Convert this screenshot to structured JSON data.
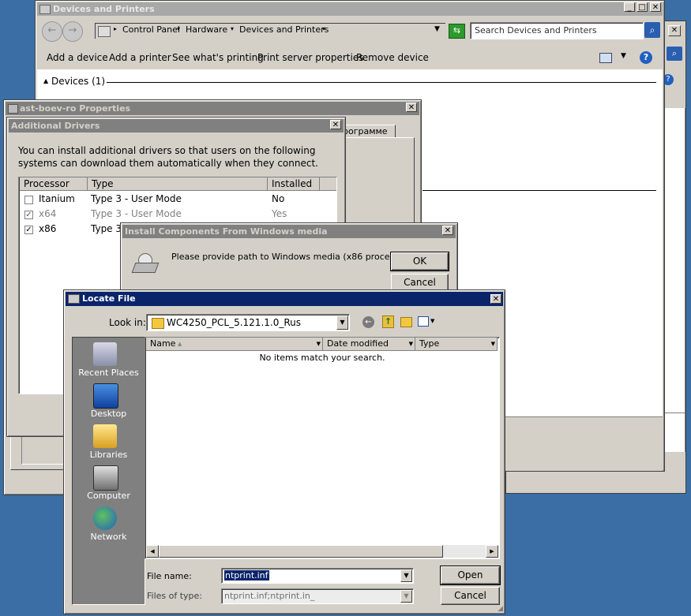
{
  "devices_window": {
    "title": "Devices and Printers",
    "breadcrumb": [
      "Control Panel",
      "Hardware",
      "Devices and Printers"
    ],
    "search_placeholder": "Search Devices and Printers",
    "toolbar": [
      "Add a device",
      "Add a printer",
      "See what's printing",
      "Print server properties",
      "Remove device"
    ],
    "devices_group": "Devices (1)"
  },
  "properties_window": {
    "title": "ast-boev-ro Properties",
    "tab_fragment": "рограмме"
  },
  "additional_drivers": {
    "title": "Additional Drivers",
    "description": "You can install additional drivers so that users on the following systems can download them automatically when they connect.",
    "columns": [
      "Processor",
      "Type",
      "Installed"
    ],
    "rows": [
      {
        "processor": "Itanium",
        "type": "Type 3 - User Mode",
        "installed": "No",
        "checked": false,
        "disabled": false
      },
      {
        "processor": "x64",
        "type": "Type 3 - User Mode",
        "installed": "Yes",
        "checked": true,
        "disabled": true
      },
      {
        "processor": "x86",
        "type": "Type 3",
        "installed": "",
        "checked": true,
        "disabled": false
      }
    ]
  },
  "install_dialog": {
    "title": "Install Components From Windows media",
    "message": "Please provide path to Windows media (x86 processor).",
    "ok_label": "OK",
    "cancel_label": "Cancel"
  },
  "locate_file": {
    "title": "Locate File",
    "look_in_label": "Look in:",
    "look_in_value": "WC4250_PCL_5.121.1.0_Rus",
    "places": [
      "Recent Places",
      "Desktop",
      "Libraries",
      "Computer",
      "Network"
    ],
    "columns": [
      "Name",
      "Date modified",
      "Type"
    ],
    "empty_message": "No items match your search.",
    "file_name_label": "File name:",
    "file_name_value": "ntprint.inf",
    "files_of_type_label": "Files of type:",
    "files_of_type_value": "ntprint.inf;ntprint.in_",
    "open_label": "Open",
    "cancel_label": "Cancel"
  },
  "colors": {
    "desktop": "#3a6ea5",
    "active_title": "#0a246a",
    "inactive_title": "#808080",
    "window_face": "#d4d0c8"
  }
}
